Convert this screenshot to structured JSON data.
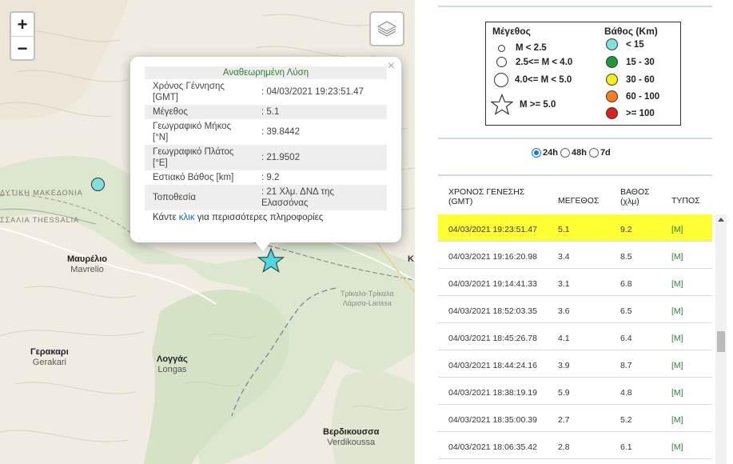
{
  "map": {
    "zoom_in": "+",
    "zoom_out": "−",
    "layers_icon": "layers-icon",
    "places": [
      {
        "name": "Μαυρέλιο",
        "sub": "Mavrelio"
      },
      {
        "name": "Γερακαρι",
        "sub": "Gerakari"
      },
      {
        "name": "Λογγάς",
        "sub": "Longas"
      },
      {
        "name": "Βερδικουσσα",
        "sub": "Verdikoussa"
      },
      {
        "name": "Τρίκαλα-Τρίκαλα",
        "sub": "Λάρισα-Larissa"
      }
    ],
    "regions": [
      "ΔΥΤΙΚΗ ΜΑΚΕΔΟΝΙΑ",
      "ΣΣΑΛΙΑ THESSALIA"
    ],
    "edge_letter": "Κ",
    "popup": {
      "close": "×",
      "title": "Αναθεωρημένη Λύση",
      "rows": [
        {
          "label": "Χρόνος Γέννησης [GMT]",
          "value": ": 04/03/2021 19:23:51.47"
        },
        {
          "label": "Μέγεθος",
          "value": ": 5.1"
        },
        {
          "label": "Γεωγραφικό Μήκος [°N]",
          "value": ": 39.8442"
        },
        {
          "label": "Γεωγραφικό Πλάτος [°E]",
          "value": ": 21.9502"
        },
        {
          "label": "Εστιακό Βάθος [km]",
          "value": ": 9.2"
        },
        {
          "label": "Τοποθεσία",
          "value": ": 21 Χλμ. ΔΝΔ της Ελασσόνας"
        }
      ],
      "more_before": "Κάντε ",
      "more_link": "κλικ",
      "more_after": " για περισσότερες πληροφορίες"
    }
  },
  "legend": {
    "size_title": "Μέγεθος",
    "depth_title": "Βάθος (Km)",
    "sizes": [
      "M < 2.5",
      "2.5<= M < 4.0",
      "4.0<= M < 5.0",
      "M >= 5.0"
    ],
    "depths": [
      {
        "label": "< 15",
        "color": "#7fe0dc"
      },
      {
        "label": "15 - 30",
        "color": "#1f9a3a"
      },
      {
        "label": "30 - 60",
        "color": "#f5ee1a"
      },
      {
        "label": "60 - 100",
        "color": "#f57f20"
      },
      {
        "label": ">= 100",
        "color": "#e02020"
      }
    ]
  },
  "period": {
    "options": [
      "24h",
      "48h",
      "7d"
    ],
    "selected": "24h"
  },
  "table": {
    "headers": {
      "time": "ΧΡΟΝΟΣ ΓΕΝΕΣΗΣ (GMT)",
      "mag": "ΜΕΓΕΘΟΣ",
      "depth": "ΒΑΘΟΣ (χλμ)",
      "type": "ΤΥΠΟΣ"
    },
    "rows": [
      {
        "time": "04/03/2021 19:23:51.47",
        "mag": "5.1",
        "depth": "9.2",
        "type": "[M]"
      },
      {
        "time": "04/03/2021 19:16:20.98",
        "mag": "3.4",
        "depth": "8.5",
        "type": "[M]"
      },
      {
        "time": "04/03/2021 19:14:41.33",
        "mag": "3.1",
        "depth": "6.8",
        "type": "[M]"
      },
      {
        "time": "04/03/2021 18:52:03.35",
        "mag": "3.6",
        "depth": "6.5",
        "type": "[M]"
      },
      {
        "time": "04/03/2021 18:45:26.78",
        "mag": "4.1",
        "depth": "6.4",
        "type": "[M]"
      },
      {
        "time": "04/03/2021 18:44:24.16",
        "mag": "3.9",
        "depth": "8.7",
        "type": "[M]"
      },
      {
        "time": "04/03/2021 18:38:19.19",
        "mag": "5.9",
        "depth": "4.8",
        "type": "[M]"
      },
      {
        "time": "04/03/2021 18:35:00.39",
        "mag": "2.7",
        "depth": "5.2",
        "type": "[M]"
      },
      {
        "time": "04/03/2021 18:06:35.42",
        "mag": "2.8",
        "depth": "6.1",
        "type": "[M]"
      }
    ]
  }
}
